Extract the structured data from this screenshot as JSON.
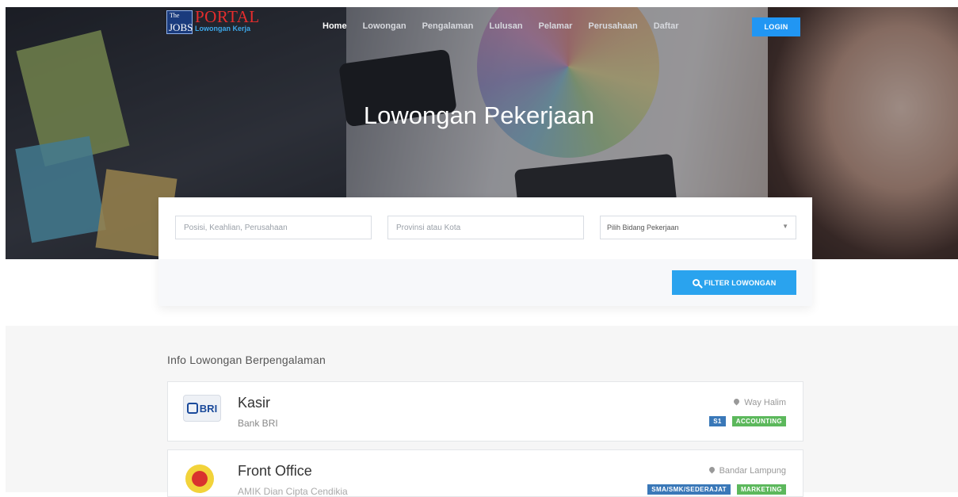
{
  "brand": {
    "the": "The",
    "jobs": "JOBS",
    "portal": "PORTAL",
    "subtitle": "Lowongan Kerja"
  },
  "nav": {
    "items": [
      "Home",
      "Lowongan",
      "Pengalaman",
      "Lulusan",
      "Pelamar",
      "Perusahaan",
      "Daftar"
    ],
    "active": "Home",
    "login_label": "LOGIN"
  },
  "hero": {
    "title": "Lowongan Pekerjaan"
  },
  "search": {
    "keyword_placeholder": "Posisi, Keahlian, Perusahaan",
    "location_placeholder": "Provinsi atau Kota",
    "category_value": "Pilih Bidang Pekerjaan",
    "filter_label": "FILTER LOWONGAN"
  },
  "listings": {
    "title": "Info Lowongan Berpengalaman",
    "items": [
      {
        "job": "Kasir",
        "company": "Bank BRI",
        "location": "Way Halim",
        "education": "S1",
        "category": "ACCOUNTING",
        "logo_text": "BRI"
      },
      {
        "job": "Front Office",
        "company": "AMIK Dian Cipta Cendikia",
        "location": "Bandar Lampung",
        "education": "SMA/SMK/SEDERAJAT",
        "category": "MARKETING"
      }
    ]
  },
  "colors": {
    "accent": "#2196f3",
    "filter": "#2aa3ee",
    "tag_blue": "#3a78b8",
    "tag_green": "#5cb85c",
    "logo_red": "#e52d2d"
  }
}
